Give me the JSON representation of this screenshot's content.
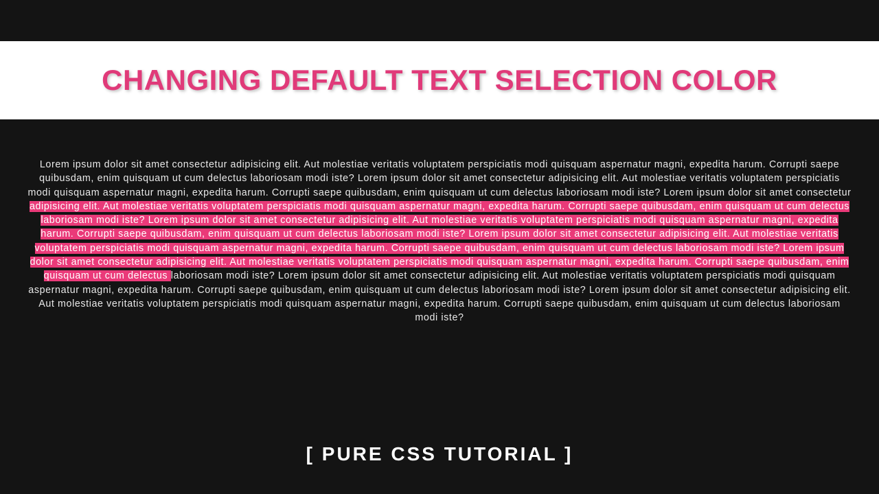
{
  "title": "CHANGING DEFAULT TEXT SELECTION COLOR",
  "footer": "[ PURE CSS TUTORIAL ]",
  "colors": {
    "accent": "#e03a79",
    "selection_bg": "#ea3a79",
    "bg": "#141414"
  },
  "para": {
    "pre": "Lorem ipsum dolor sit amet consectetur adipisicing elit. Aut molestiae veritatis voluptatem perspiciatis modi quisquam aspernatur magni, expedita harum. Corrupti saepe quibusdam, enim quisquam ut cum delectus laboriosam modi iste? Lorem ipsum dolor sit amet consectetur adipisicing elit. Aut molestiae veritatis voluptatem perspiciatis modi quisquam aspernatur magni, expedita harum. Corrupti saepe quibusdam, enim quisquam ut cum delectus laboriosam modi iste? Lorem ipsum dolor sit amet consectetur ",
    "sel": "adipisicing elit. Aut molestiae veritatis voluptatem perspiciatis modi quisquam aspernatur magni, expedita harum. Corrupti saepe quibusdam, enim quisquam ut cum delectus laboriosam modi iste? Lorem ipsum dolor sit amet consectetur adipisicing elit. Aut molestiae veritatis voluptatem perspiciatis modi quisquam aspernatur magni, expedita harum. Corrupti saepe quibusdam, enim quisquam ut cum delectus laboriosam modi iste? Lorem ipsum dolor sit amet consectetur adipisicing elit. Aut molestiae veritatis voluptatem perspiciatis modi quisquam aspernatur magni, expedita harum. Corrupti saepe quibusdam, enim quisquam ut cum delectus laboriosam modi iste? Lorem ipsum dolor sit amet consectetur adipisicing elit. Aut molestiae veritatis voluptatem perspiciatis modi quisquam aspernatur magni, expedita harum. Corrupti saepe quibusdam, enim quisquam ut cum delectus ",
    "post": "laboriosam modi iste? Lorem ipsum dolor sit amet consectetur adipisicing elit. Aut molestiae veritatis voluptatem perspiciatis modi quisquam aspernatur magni, expedita harum. Corrupti saepe quibusdam, enim quisquam ut cum delectus laboriosam modi iste? Lorem ipsum dolor sit amet consectetur adipisicing elit. Aut molestiae veritatis voluptatem perspiciatis modi quisquam aspernatur magni, expedita harum. Corrupti saepe quibusdam, enim quisquam ut cum delectus laboriosam modi iste?"
  }
}
